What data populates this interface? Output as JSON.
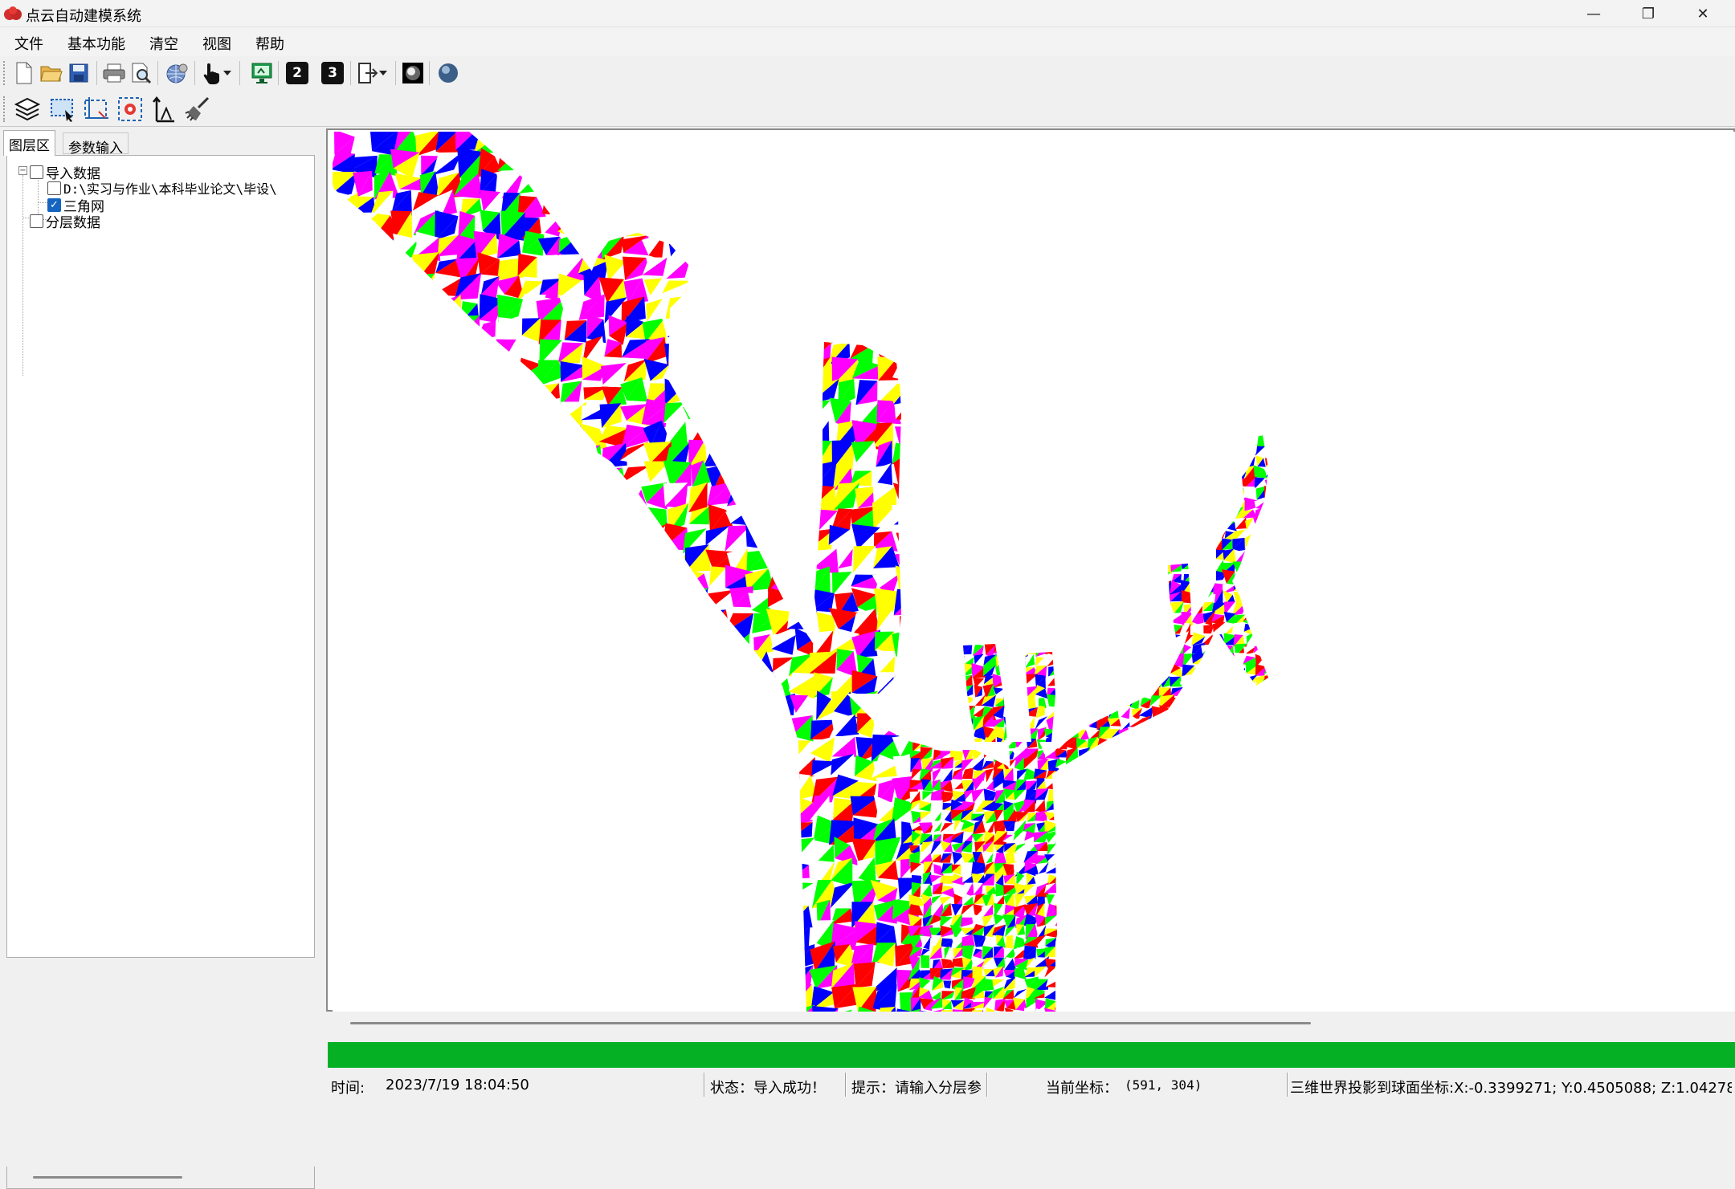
{
  "window": {
    "title": "点云自动建模系统",
    "minimize_glyph": "—",
    "maximize_glyph": "❐",
    "close_glyph": "✕"
  },
  "menu": [
    "文件",
    "基本功能",
    "清空",
    "视图",
    "帮助"
  ],
  "toolbar1": {
    "icons": [
      "new-file-icon",
      "open-folder-icon",
      "save-icon",
      "print-icon",
      "print-preview-icon",
      "globe-settings-icon",
      "hand-pointer-icon",
      "dropdown-arrow-icon",
      "monitor-icon",
      "view-2d-icon",
      "view-3d-icon",
      "export-icon",
      "sphere-black-icon",
      "sphere-blue-icon"
    ],
    "view2d_label": "2",
    "view3d_label": "3"
  },
  "toolbar2": {
    "icons": [
      "layers-icon",
      "select-rect-icon",
      "select-crop-icon",
      "point-target-icon",
      "axis-icon",
      "broom-icon"
    ]
  },
  "left_panel": {
    "tabs": [
      "图层区",
      "参数输入"
    ],
    "tree": {
      "root1": {
        "label": "导入数据",
        "checked": false,
        "expander": "−"
      },
      "child_path": {
        "label": "D:\\实习与作业\\本科毕业论文\\毕设\\",
        "checked": false
      },
      "child_mesh": {
        "label": "三角网",
        "checked": true
      },
      "root2": {
        "label": "分层数据",
        "checked": false
      }
    }
  },
  "viewport": {
    "content": "triangulated-tree-mesh",
    "palette": [
      "#ff0000",
      "#00ff00",
      "#0000ff",
      "#ffff00",
      "#ff00ff",
      "#ffffff"
    ]
  },
  "statusbar": {
    "time_label": "时间:",
    "time_value": "2023/7/19 18:04:50",
    "state": "状态：导入成功！",
    "hint": "提示：请输入分层参",
    "coord_label": "当前坐标：",
    "coord_value": "(591, 304)",
    "sphere_coord": "三维世界投影到球面坐标:X:-0.3399271; Y:0.4505088; Z:1.04278"
  },
  "colors": {
    "progress_green": "#06b025",
    "check_blue": "#1565c0"
  }
}
